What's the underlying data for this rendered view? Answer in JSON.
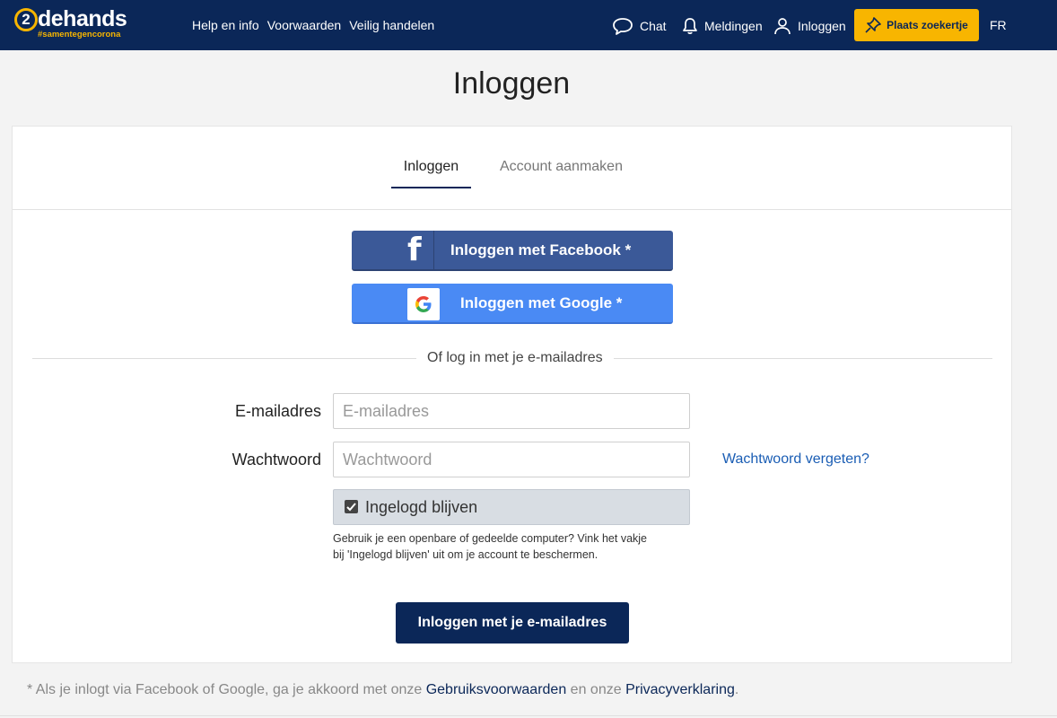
{
  "header": {
    "logo_digit": "2",
    "logo_word": "dehands",
    "logo_tag": "#samentegencorona",
    "nav": [
      "Help en info",
      "Voorwaarden",
      "Veilig handelen"
    ],
    "chat": "Chat",
    "notifications": "Meldingen",
    "login": "Inloggen",
    "place_ad": "Plaats zoekertje",
    "language": "FR"
  },
  "page": {
    "title": "Inloggen"
  },
  "tabs": {
    "login": "Inloggen",
    "create_account": "Account aanmaken"
  },
  "social": {
    "facebook": "Inloggen met Facebook *",
    "google": "Inloggen met Google *"
  },
  "divider_text": "Of log in met je e-mailadres",
  "form": {
    "email_label": "E-mailadres",
    "email_placeholder": "E-mailadres",
    "email_value": "",
    "password_label": "Wachtwoord",
    "password_placeholder": "Wachtwoord",
    "password_value": "",
    "forgot": "Wachtwoord vergeten?",
    "remember": "Ingelogd blijven",
    "remember_checked": true,
    "note": "Gebruik je een openbare of gedeelde computer? Vink het vakje bij 'Ingelogd blijven' uit om je account te beschermen.",
    "submit": "Inloggen met je e-mailadres"
  },
  "footer": {
    "prefix": "* Als je inlogt via Facebook of Google, ga je akkoord met onze ",
    "terms": "Gebruiksvoorwaarden",
    "middle": " en onze ",
    "privacy": "Privacyverklaring",
    "suffix": "."
  },
  "colors": {
    "navy": "#0b2758",
    "accent_yellow": "#f8b500",
    "facebook": "#3b5998",
    "google": "#4a8af4",
    "link": "#1a5db4"
  },
  "icons": [
    "chat-icon",
    "bell-icon",
    "user-icon",
    "pin-icon",
    "facebook-icon",
    "google-icon",
    "checkmark-icon"
  ]
}
